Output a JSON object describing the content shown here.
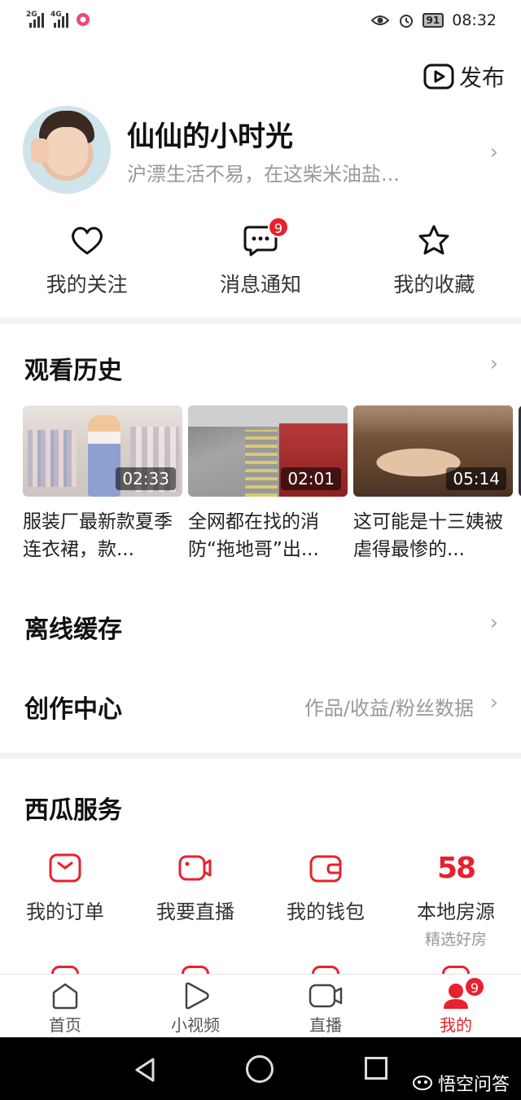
{
  "status_bar": {
    "signal1": "2G",
    "signal2": "4G",
    "battery": "91",
    "time": "08:32"
  },
  "header": {
    "publish_label": "发布"
  },
  "profile": {
    "name": "仙仙的小时光",
    "bio": "沪漂生活不易，在这柴米油盐..."
  },
  "quick_actions": [
    {
      "label": "我的关注",
      "icon": "heart-icon"
    },
    {
      "label": "消息通知",
      "icon": "message-icon",
      "badge": "9"
    },
    {
      "label": "我的收藏",
      "icon": "star-icon"
    }
  ],
  "history": {
    "title": "观看历史",
    "items": [
      {
        "title": "服装厂最新款夏季连衣裙，款...",
        "duration": "02:33"
      },
      {
        "title": "全网都在找的消防“拖地哥”出...",
        "duration": "02:01"
      },
      {
        "title": "这可能是十三姨被虐得最惨的...",
        "duration": "05:14"
      }
    ]
  },
  "offline": {
    "title": "离线缓存"
  },
  "creator": {
    "title": "创作中心",
    "hint": "作品/收益/粉丝数据"
  },
  "services": {
    "title": "西瓜服务",
    "items": [
      {
        "label": "我的订单",
        "icon": "order-icon"
      },
      {
        "label": "我要直播",
        "icon": "live-icon"
      },
      {
        "label": "我的钱包",
        "icon": "wallet-icon"
      },
      {
        "label": "本地房源",
        "sub": "精选好房",
        "icon_text": "58"
      }
    ]
  },
  "tabbar": {
    "items": [
      {
        "label": "首页",
        "icon": "home-icon"
      },
      {
        "label": "小视频",
        "icon": "play-icon"
      },
      {
        "label": "直播",
        "icon": "camera-icon"
      },
      {
        "label": "我的",
        "icon": "profile-icon",
        "badge": "9",
        "active": true
      }
    ]
  },
  "watermark": "悟空问答",
  "colors": {
    "accent": "#e8212d",
    "text": "#222222",
    "muted": "#999999"
  }
}
